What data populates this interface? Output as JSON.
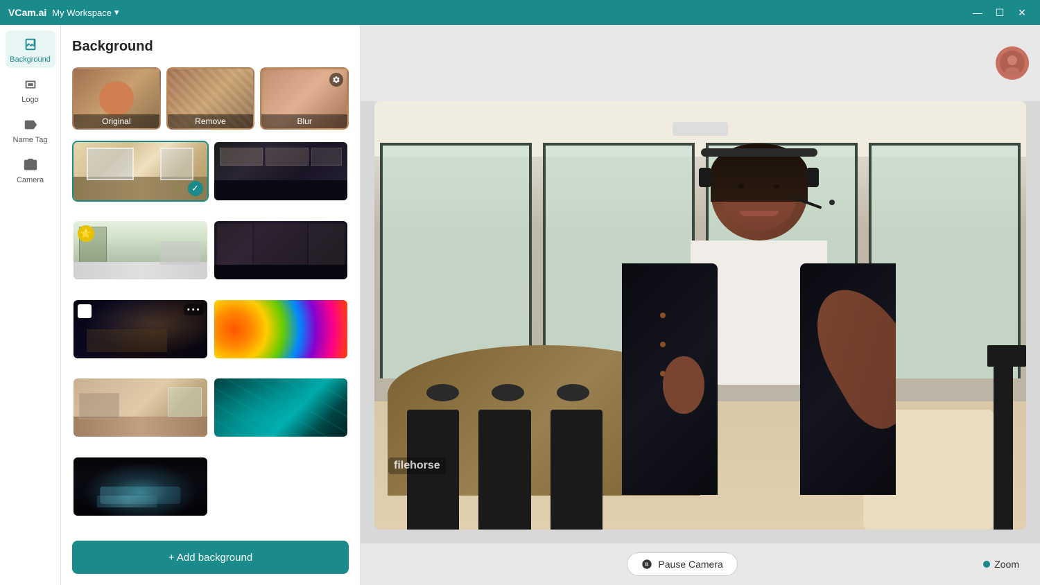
{
  "app": {
    "logo": "VCam.ai",
    "workspace": "My Workspace",
    "workspace_dropdown": "▾"
  },
  "titlebar": {
    "minimize": "—",
    "maximize": "☐",
    "close": "✕"
  },
  "sidebar": {
    "items": [
      {
        "id": "background",
        "label": "Background",
        "active": true
      },
      {
        "id": "logo",
        "label": "Logo",
        "active": false
      },
      {
        "id": "nametag",
        "label": "Name Tag",
        "active": false
      },
      {
        "id": "camera",
        "label": "Camera",
        "active": false
      }
    ]
  },
  "panel": {
    "title": "Background",
    "presets": [
      {
        "id": "original",
        "label": "Original",
        "has_gear": false
      },
      {
        "id": "remove",
        "label": "Remove",
        "has_gear": false
      },
      {
        "id": "blur",
        "label": "Blur",
        "has_gear": true
      }
    ],
    "backgrounds": [
      {
        "id": "bg1",
        "style": "bg-office-light",
        "selected": true,
        "has_check": true
      },
      {
        "id": "bg2",
        "style": "bg-office-dark",
        "selected": false
      },
      {
        "id": "bg3",
        "style": "bg-modern",
        "selected": false,
        "has_star": true
      },
      {
        "id": "bg4",
        "style": "bg-dark-room",
        "selected": false
      },
      {
        "id": "bg5",
        "style": "bg-dark-bar",
        "selected": false,
        "has_white": true,
        "has_more": true
      },
      {
        "id": "bg6",
        "style": "bg-colorful",
        "selected": false
      },
      {
        "id": "bg7",
        "style": "bg-living",
        "selected": false
      },
      {
        "id": "bg8",
        "style": "bg-teal-wave",
        "selected": false
      },
      {
        "id": "bg9",
        "style": "bg-laptop",
        "selected": false
      }
    ],
    "add_button": "+ Add background"
  },
  "preview": {
    "pause_label": "Pause Camera",
    "zoom_label": "Zoom"
  },
  "watermark": "filehorse"
}
